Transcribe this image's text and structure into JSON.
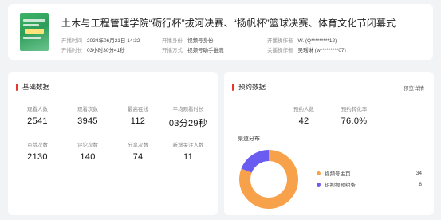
{
  "live": {
    "title": "土木与工程管理学院“砺行杯”拔河决赛、“扬帆杯”篮球决赛、体育文化节闭幕式",
    "fields": [
      {
        "key": "开播时间",
        "value": "2024年06月21日 14:32"
      },
      {
        "key": "开播身份",
        "value": "视频号身份"
      },
      {
        "key": "开播操作者",
        "value": "W. (Q*********12)"
      },
      {
        "key": "开播时长",
        "value": "03小时30分41秒"
      },
      {
        "key": "开播方式",
        "value": "视频号助手推流"
      },
      {
        "key": "关播操作者",
        "value": "吴瑶琳 (w*********07)"
      }
    ]
  },
  "basic": {
    "title": "基础数据",
    "stats": [
      {
        "label": "观看人数",
        "value": "2541"
      },
      {
        "label": "观看次数",
        "value": "3945"
      },
      {
        "label": "最高在线",
        "value": "112"
      },
      {
        "label": "平均观看时长",
        "value": "03分29秒"
      },
      {
        "label": "点赞次数",
        "value": "2130"
      },
      {
        "label": "评论次数",
        "value": "140"
      },
      {
        "label": "分享次数",
        "value": "74"
      },
      {
        "label": "新增关注人数",
        "value": "11"
      }
    ]
  },
  "reservation": {
    "title": "预约数据",
    "detail_link": "预览详情",
    "stats": [
      {
        "label": "预约人数",
        "value": "42"
      },
      {
        "label": "预约转化率",
        "value": "76.0%"
      }
    ],
    "channel_title": "渠道分布",
    "channels": [
      {
        "name": "视频号主页",
        "value": 34,
        "color": "#f7a24a"
      },
      {
        "name": "短视频预约条",
        "value": 8,
        "color": "#6a5cf0"
      }
    ]
  }
}
